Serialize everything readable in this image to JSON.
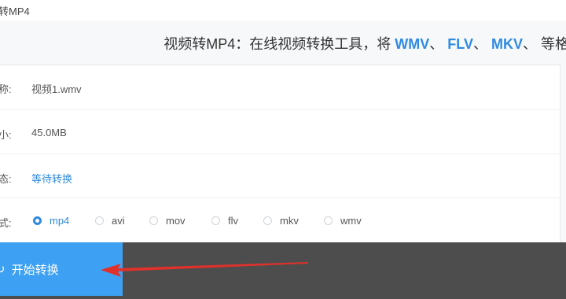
{
  "tab": {
    "title": "转MP4"
  },
  "headline": {
    "prefix": "视频转MP4：在线视频转换工具，将 ",
    "formats": [
      "WMV",
      "FLV",
      "MKV"
    ],
    "separator": "、 ",
    "suffix": "等格"
  },
  "rows": {
    "name": {
      "label": "称:",
      "value": "视频1.wmv"
    },
    "size": {
      "label": "小:",
      "value": "45.0MB"
    },
    "status": {
      "label": "态:",
      "value": "等待转换"
    },
    "format": {
      "label": "式:"
    }
  },
  "format_options": [
    {
      "label": "mp4",
      "selected": true
    },
    {
      "label": "avi",
      "selected": false
    },
    {
      "label": "mov",
      "selected": false
    },
    {
      "label": "flv",
      "selected": false
    },
    {
      "label": "mkv",
      "selected": false
    },
    {
      "label": "wmv",
      "selected": false
    }
  ],
  "start_button": {
    "label": "开始转换",
    "icon": "refresh-icon"
  },
  "colors": {
    "accent": "#2f8ae0",
    "button": "#3ea0f2",
    "arrow": "#e0312b",
    "footer": "#4d4d4d"
  }
}
